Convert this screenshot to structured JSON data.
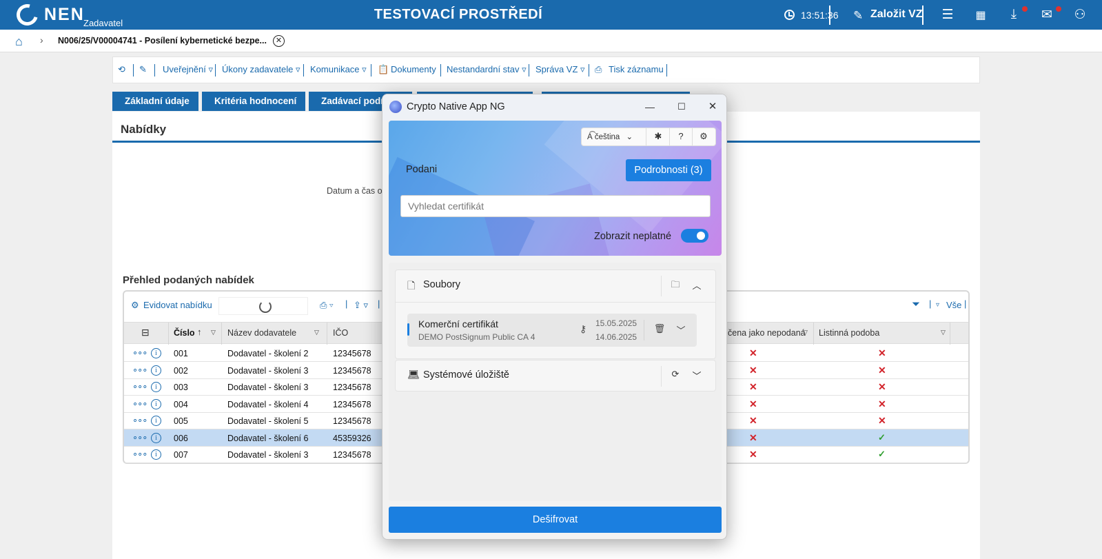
{
  "header": {
    "logo_text": "NEN",
    "logo_sub": "Zadavatel",
    "env_title": "TESTOVACÍ PROSTŘEDÍ",
    "time": "13:51:36",
    "create_label": "Založit VZ",
    "icons": [
      "menu-icon",
      "calendar-icon",
      "download-icon",
      "mail-icon",
      "user-icon"
    ]
  },
  "breadcrumb": {
    "text": "N006/25/V00004741 - Posílení kybernetické bezpe..."
  },
  "toolbar": {
    "publish": "Uveřejnění ▿",
    "actions": "Úkony zadavatele ▿",
    "communication": "Komunikace ▿",
    "documents": "Dokumenty",
    "nonstandard": "Nestandardní stav ▿",
    "management": "Správa VZ ▿",
    "print": "Tisk záznamu"
  },
  "tabs": [
    "Základní údaje",
    "Kritéria hodnocení",
    "Zadávací podm"
  ],
  "panel": {
    "title": "Nabídky",
    "date_text": "Datum a čas o",
    "overview_title": "Přehled podaných nabídek"
  },
  "grid": {
    "register_label": "Evidovat nabídku",
    "all_label": "Vše",
    "columns": {
      "number": "Číslo",
      "supplier": "Název dodavatele",
      "ico": "IČO",
      "not_submitted": "čena jako nepodaná",
      "paper": "Listinná podoba"
    },
    "rows": [
      {
        "num": "001",
        "supplier": "Dodavatel - školení 2",
        "ico": "12345678",
        "paper": "x",
        "selected": false
      },
      {
        "num": "002",
        "supplier": "Dodavatel - školení 3",
        "ico": "12345678",
        "paper": "x",
        "selected": false
      },
      {
        "num": "003",
        "supplier": "Dodavatel - školení 3",
        "ico": "12345678",
        "paper": "x",
        "selected": false
      },
      {
        "num": "004",
        "supplier": "Dodavatel - školení 4",
        "ico": "12345678",
        "paper": "x",
        "selected": false
      },
      {
        "num": "005",
        "supplier": "Dodavatel - školení 5",
        "ico": "12345678",
        "paper": "x",
        "selected": false
      },
      {
        "num": "006",
        "supplier": "Dodavatel - školení 6",
        "ico": "45359326",
        "paper": "ok",
        "selected": true
      },
      {
        "num": "007",
        "supplier": "Dodavatel - školení 3",
        "ico": "12345678",
        "paper": "ok",
        "selected": false
      }
    ]
  },
  "dialog": {
    "title": "Crypto Native App NG",
    "language": "čeština",
    "podani": "Podani",
    "details_button": "Podrobnosti (3)",
    "search_placeholder": "Vyhledat certifikát",
    "toggle_label": "Zobrazit neplatné",
    "toggle_on": true,
    "files_section": "Soubory",
    "certificate": {
      "name": "Komerční certifikát",
      "issuer": "DEMO PostSignum Public CA 4",
      "valid_from": "15.05.2025",
      "valid_to": "14.06.2025"
    },
    "system_section": "Systémové úložiště",
    "decrypt_button": "Dešifrovat"
  },
  "colors": {
    "brand_blue": "#1a6aad",
    "dialog_accent": "#1b7fe0",
    "selected_row": "#c3daf3",
    "error_red": "#d2232a",
    "ok_green": "#2e9e2e"
  }
}
